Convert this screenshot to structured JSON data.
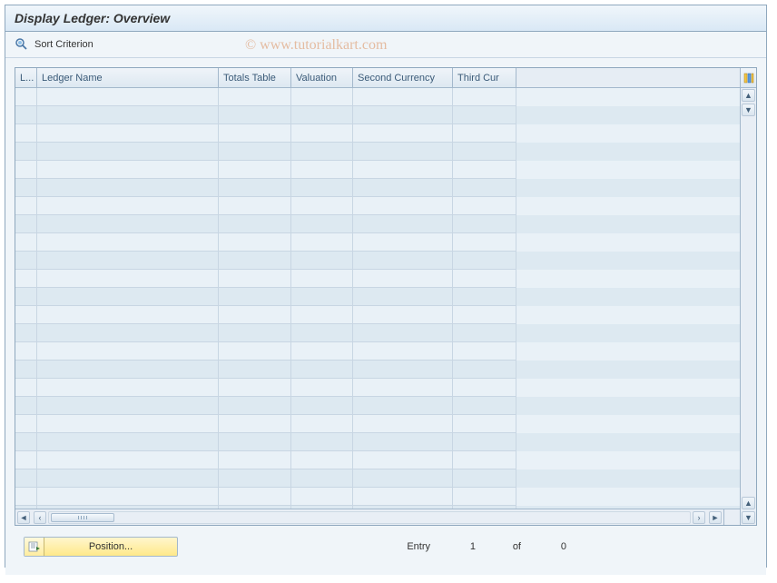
{
  "title": "Display Ledger: Overview",
  "toolbar": {
    "sort_label": "Sort Criterion"
  },
  "table": {
    "columns": [
      "L...",
      "Ledger Name",
      "Totals Table",
      "Valuation",
      "Second Currency",
      "Third Cur"
    ],
    "row_count": 24
  },
  "footer": {
    "position_label": "Position...",
    "entry_label": "Entry",
    "entry_current": "1",
    "entry_of_label": "of",
    "entry_total": "0"
  },
  "watermark": {
    "copyright": "©",
    "text": "www.tutorialkart.com"
  }
}
